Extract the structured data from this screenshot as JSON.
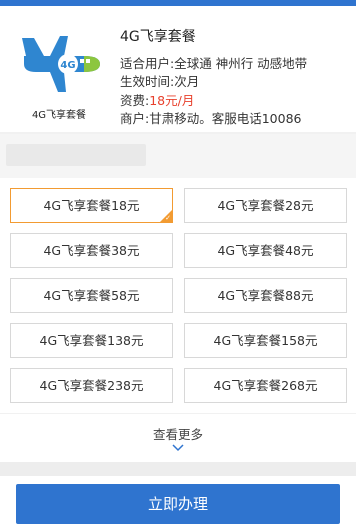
{
  "product": {
    "title": "4G飞享套餐",
    "logo_caption": "4G飞享套餐",
    "badge_text": "4G",
    "users_label": "适合用户:",
    "users_value": "全球通 神州行 动感地带",
    "effective_label": "生效时间:",
    "effective_value": "次月",
    "fee_label": "资费:",
    "fee_value": "18元/月",
    "merchant_label": "商户:",
    "merchant_value": "甘肃移动。客服电话10086"
  },
  "plans": [
    {
      "label": "4G飞享套餐18元",
      "selected": true
    },
    {
      "label": "4G飞享套餐28元",
      "selected": false
    },
    {
      "label": "4G飞享套餐38元",
      "selected": false
    },
    {
      "label": "4G飞享套餐48元",
      "selected": false
    },
    {
      "label": "4G飞享套餐58元",
      "selected": false
    },
    {
      "label": "4G飞享套餐88元",
      "selected": false
    },
    {
      "label": "4G飞享套餐138元",
      "selected": false
    },
    {
      "label": "4G飞享套餐158元",
      "selected": false
    },
    {
      "label": "4G飞享套餐238元",
      "selected": false
    },
    {
      "label": "4G飞享套餐268元",
      "selected": false
    }
  ],
  "more": {
    "label": "查看更多",
    "icon": "chevron-down-icon"
  },
  "action": {
    "label": "立即办理"
  },
  "colors": {
    "brand": "#2f74cf",
    "accent": "#f29b32",
    "price": "#e8412d",
    "plane_green": "#8cc63f"
  }
}
